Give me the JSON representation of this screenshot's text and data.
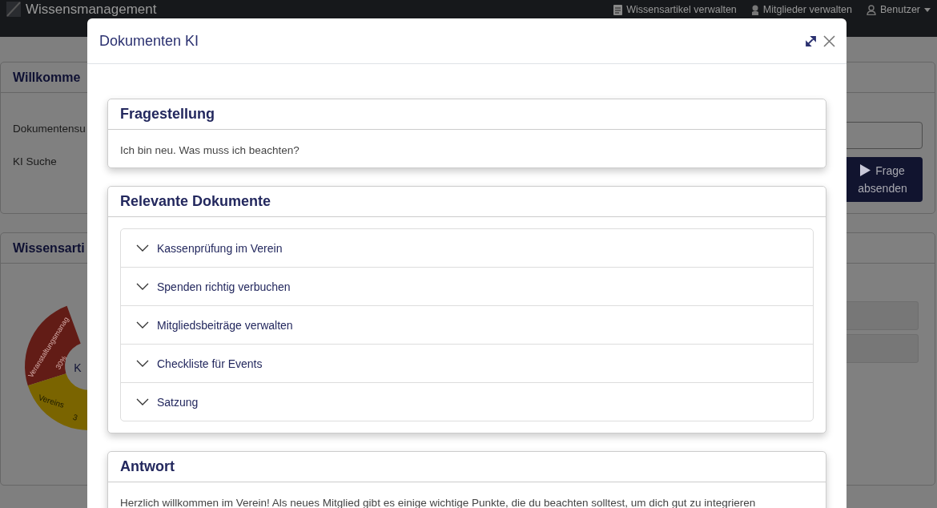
{
  "navbar": {
    "brand": "Wissensmanagement",
    "links": [
      {
        "kind": "link",
        "label": "Wissensartikel verwalten"
      },
      {
        "kind": "link",
        "label": "Mitglieder verwalten"
      },
      {
        "kind": "dropdown",
        "label": "Benutzer"
      }
    ]
  },
  "background": {
    "welcome_card": {
      "title": "Willkomme",
      "rows": [
        {
          "label": "Dokumentensu"
        },
        {
          "label": "KI Suche"
        }
      ],
      "submit_button": "Frage absenden"
    },
    "articles_card": {
      "title": "Wissensarti",
      "center_label": "K",
      "segments": [
        {
          "label": "Veranstaltungsmanag",
          "share": "30%",
          "color": "#621c16"
        },
        {
          "label": "Vereins",
          "share": "3",
          "color": "#7a6400"
        }
      ]
    }
  },
  "modal": {
    "title": "Dokumenten KI",
    "sections": [
      {
        "kind": "text",
        "title": "Fragestellung",
        "text": "Ich bin neu. Was muss ich beachten?"
      },
      {
        "kind": "accordion",
        "title": "Relevante Dokumente",
        "items": [
          {
            "label": "Kassenprüfung im Verein",
            "expanded": false
          },
          {
            "label": "Spenden richtig verbuchen",
            "expanded": false
          },
          {
            "label": "Mitgliedsbeiträge verwalten",
            "expanded": false
          },
          {
            "label": "Checkliste für Events",
            "expanded": false
          },
          {
            "label": "Satzung",
            "expanded": false
          }
        ]
      },
      {
        "kind": "text",
        "title": "Antwort",
        "text": "Herzlich willkommen im Verein! Als neues Mitglied gibt es einige wichtige Punkte, die du beachten solltest, um dich gut zu integrieren"
      }
    ]
  }
}
